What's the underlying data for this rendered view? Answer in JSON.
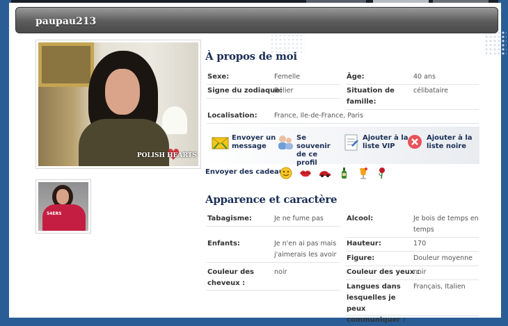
{
  "profile": {
    "username": "paupau213",
    "photo_watermark": "POLISH HEARTS",
    "thumb_shirt_text": "54ERS"
  },
  "about": {
    "title": "À propos de moi",
    "rows": [
      {
        "label": "Sexe:",
        "value": "Femelle"
      },
      {
        "label": "Âge:",
        "value": "40 ans"
      },
      {
        "label": "Signe du zodiaque:",
        "value": "Bélier"
      },
      {
        "label": "Situation de famille:",
        "value": "célibataire"
      },
      {
        "label": "Localisation:",
        "value": "France, Ile-de-France, Paris"
      }
    ]
  },
  "actions": [
    {
      "label": "Envoyer un message",
      "icon": "envelope-icon"
    },
    {
      "label": "Se souvenir de ce profil",
      "icon": "users-icon"
    },
    {
      "label": "Ajouter à la liste VIP",
      "icon": "document-icon"
    },
    {
      "label": "Ajouter à la liste noire",
      "icon": "block-icon"
    }
  ],
  "gifts": {
    "label": "Envoyer des cadeaux",
    "items": [
      "smiley-gift-icon",
      "lips-gift-icon",
      "car-gift-icon",
      "bottle-gift-icon",
      "cocktail-gift-icon",
      "rose-gift-icon"
    ]
  },
  "appearance": {
    "title": "Apparence et caractère",
    "rows": [
      {
        "label": "Tabagisme:",
        "value": "Je ne fume pas"
      },
      {
        "label": "Alcool:",
        "value": "Je bois de temps en temps"
      },
      {
        "label": "Enfants:",
        "value": "Je n'en ai pas mais j'aimerais les avoir"
      },
      {
        "label": "Hauteur:",
        "value": "170"
      },
      {
        "label": "Figure:",
        "value": "Douleur moyenne"
      },
      {
        "label": "Couleur des cheveux :",
        "value": "noir"
      },
      {
        "label": "Couleur des yeux :",
        "value": "noir"
      },
      {
        "label": "Langues dans lesquelles je peux communiquer :",
        "value": "Français, Italien"
      }
    ]
  },
  "colors": {
    "page_bg": "#2a5d95",
    "heading": "#1b2f56",
    "header_bar": "#5c5c5c"
  }
}
